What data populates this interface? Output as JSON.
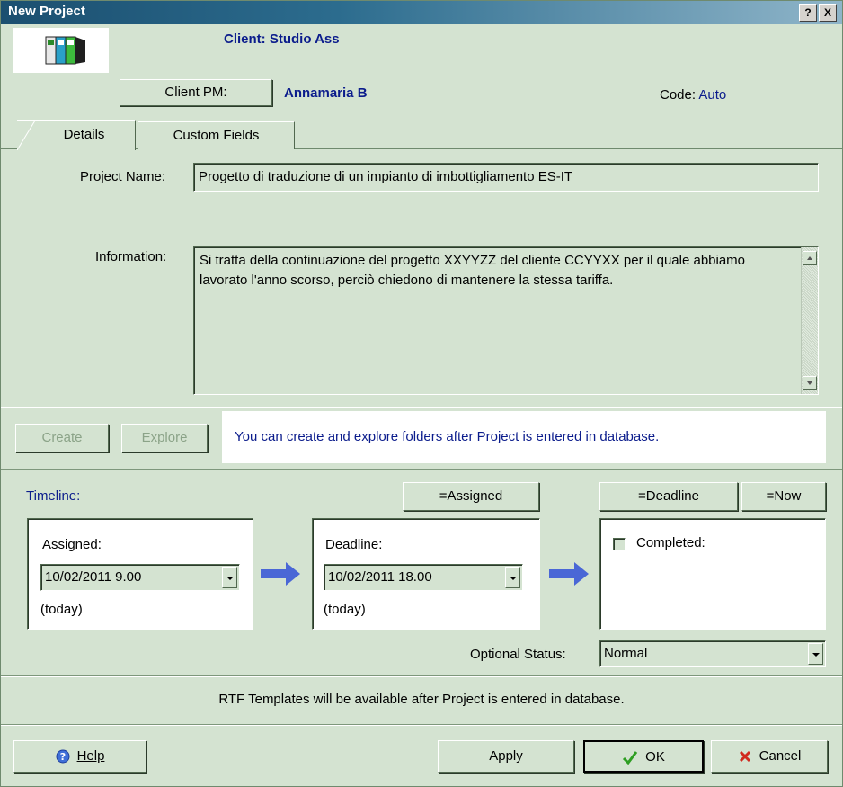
{
  "window": {
    "title": "New Project",
    "help_button": "?",
    "close_button": "X"
  },
  "header": {
    "client_label": "Client: Studio Ass",
    "client_pm_button": "Client PM:",
    "client_pm_value": "Annamaria B",
    "code_label": "Code:",
    "code_value": "Auto"
  },
  "tabs": [
    {
      "label": "Details",
      "active": true
    },
    {
      "label": "Custom Fields",
      "active": false
    }
  ],
  "details": {
    "project_name_label": "Project Name:",
    "project_name_value": "Progetto di traduzione di un impianto di imbottigliamento ES-IT",
    "information_label": "Information:",
    "information_value": "Si tratta della continuazione del progetto XXYYZZ del cliente CCYYXX per il quale abbiamo lavorato l'anno scorso, perciò chiedono di mantenere la stessa tariffa."
  },
  "folders": {
    "create_button": "Create",
    "explore_button": "Explore",
    "note": "You can create and explore folders after Project is entered in database."
  },
  "timeline": {
    "label": "Timeline:",
    "assigned_set_button": "=Assigned",
    "deadline_set_button": "=Deadline",
    "now_button": "=Now",
    "assigned": {
      "label": "Assigned:",
      "value": "10/02/2011 9.00",
      "note": "(today)"
    },
    "deadline": {
      "label": "Deadline:",
      "value": "10/02/2011 18.00",
      "note": "(today)"
    },
    "completed": {
      "label": "Completed:",
      "checked": false
    },
    "optional_status_label": "Optional Status:",
    "optional_status_value": "Normal"
  },
  "templates_note": "RTF Templates will be available after Project is entered in database.",
  "footer": {
    "help_button": "Help",
    "apply_button": "Apply",
    "ok_button": "OK",
    "cancel_button": "Cancel"
  },
  "colors": {
    "dialog_bg": "#d4e3d1",
    "title_bar": "#1b4f70",
    "accent_text": "#0b1c8c",
    "arrow": "#4a67d6"
  },
  "icons": [
    "binders-icon",
    "help-circle-icon",
    "check-icon",
    "cross-icon",
    "dropdown-arrow-icon",
    "right-arrow-icon"
  ]
}
